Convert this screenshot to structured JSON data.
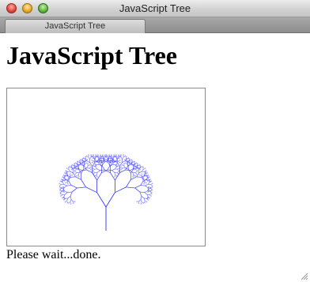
{
  "window": {
    "title": "JavaScript Tree"
  },
  "tab": {
    "label": "JavaScript Tree"
  },
  "page": {
    "heading": "JavaScript Tree",
    "status": "Please wait...done."
  },
  "colors": {
    "tree_stroke": "#0000ff"
  }
}
